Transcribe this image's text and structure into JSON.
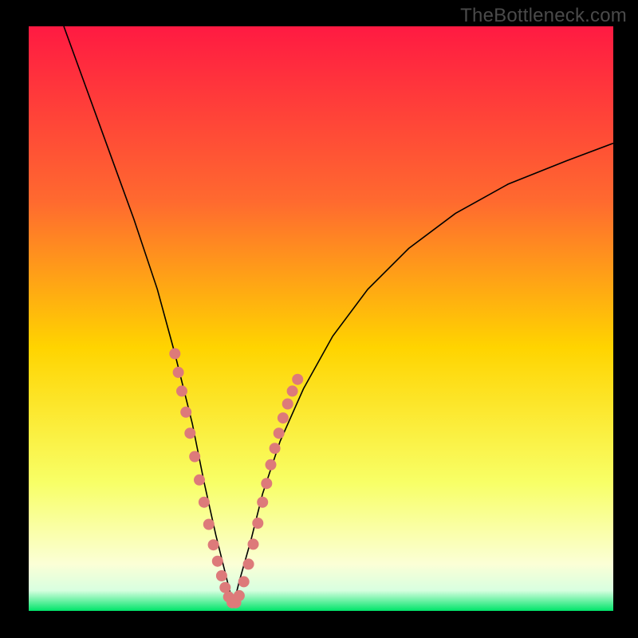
{
  "watermark": "TheBottleneck.com",
  "colors": {
    "frame_bg": "#000000",
    "watermark_text": "#4a4a4a",
    "curve_stroke": "#000000",
    "dot_fill": "#dd7a7a",
    "gradient_top": "#ff1a42",
    "gradient_mid_upper": "#ff6a2f",
    "gradient_mid": "#ffd400",
    "gradient_lower": "#f8ff66",
    "gradient_near_bottom": "#fbffd6",
    "gradient_bottom": "#00e46a"
  },
  "chart_data": {
    "type": "line",
    "title": "",
    "xlabel": "",
    "ylabel": "",
    "xlim": [
      0,
      100
    ],
    "ylim": [
      0,
      100
    ],
    "grid": false,
    "legend": false,
    "optimum_x": 35,
    "curve": {
      "x": [
        6,
        10,
        14,
        18,
        22,
        25,
        28,
        30,
        32,
        34,
        35,
        36,
        38,
        40,
        43,
        47,
        52,
        58,
        65,
        73,
        82,
        92,
        100
      ],
      "y": [
        100,
        89,
        78,
        67,
        55,
        44,
        32,
        22,
        13,
        5,
        1,
        5,
        12,
        20,
        29,
        38,
        47,
        55,
        62,
        68,
        73,
        77,
        80
      ]
    },
    "highlight_points": {
      "x": [
        25.0,
        25.6,
        26.2,
        26.9,
        27.6,
        28.4,
        29.2,
        30.0,
        30.8,
        31.6,
        32.3,
        33.0,
        33.6,
        34.2,
        34.8,
        35.4,
        36.0,
        36.8,
        37.6,
        38.4,
        39.2,
        40.0,
        40.7,
        41.4,
        42.1,
        42.8,
        43.5,
        44.3,
        45.1,
        46.0
      ],
      "y": [
        44.0,
        40.8,
        37.6,
        34.0,
        30.4,
        26.4,
        22.4,
        18.6,
        14.8,
        11.3,
        8.5,
        6.0,
        4.0,
        2.4,
        1.4,
        1.4,
        2.6,
        5.0,
        8.0,
        11.4,
        15.0,
        18.6,
        21.8,
        25.0,
        27.8,
        30.4,
        33.0,
        35.4,
        37.6,
        39.6
      ]
    }
  }
}
